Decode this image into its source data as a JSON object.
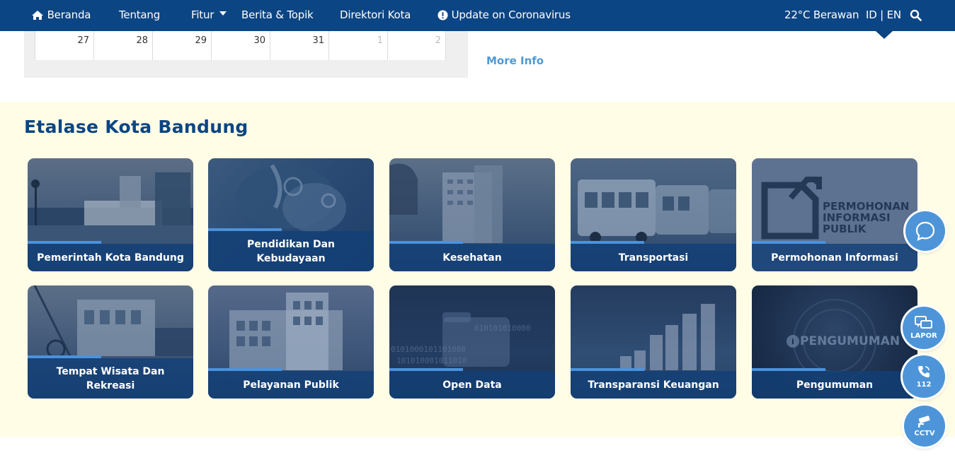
{
  "nav": {
    "items": [
      {
        "label": "Beranda",
        "icon": "home-icon"
      },
      {
        "label": "Tentang"
      },
      {
        "label": "Fitur",
        "icon": "caret-down-icon"
      },
      {
        "label": "Berita & Topik"
      },
      {
        "label": "Direktori Kota"
      },
      {
        "label": "Update on Coronavirus",
        "icon": "alert-icon"
      }
    ],
    "weather": "22°C Berawan",
    "language": "ID | EN",
    "search_icon": "search-icon"
  },
  "calendar": {
    "days": [
      "27",
      "28",
      "29",
      "30",
      "31",
      "1",
      "2"
    ]
  },
  "more_info": "More Info",
  "etalase": {
    "title": "Etalase Kota Bandung",
    "tiles": [
      {
        "label": "Pemerintah Kota Bandung"
      },
      {
        "label": "Pendidikan Dan Kebudayaan"
      },
      {
        "label": "Kesehatan"
      },
      {
        "label": "Transportasi"
      },
      {
        "label": "Permohonan Informasi",
        "art_text": "PERMOHONAN INFORMASI PUBLIK"
      },
      {
        "label": "Tempat Wisata Dan Rekreasi"
      },
      {
        "label": "Pelayanan Publik"
      },
      {
        "label": "Open Data"
      },
      {
        "label": "Transparansi Keuangan"
      },
      {
        "label": "Pengumuman",
        "art_text": "PENGUMUMAN"
      }
    ]
  },
  "floating": {
    "chat_icon": "chat-bubble-icon",
    "lapor": "LAPOR",
    "call": "112",
    "cctv": "CCTV"
  },
  "colors": {
    "navbar": "#0c4584",
    "accent": "#4b92db",
    "section_bg": "#fffde6",
    "fab": "#4d95d8"
  }
}
